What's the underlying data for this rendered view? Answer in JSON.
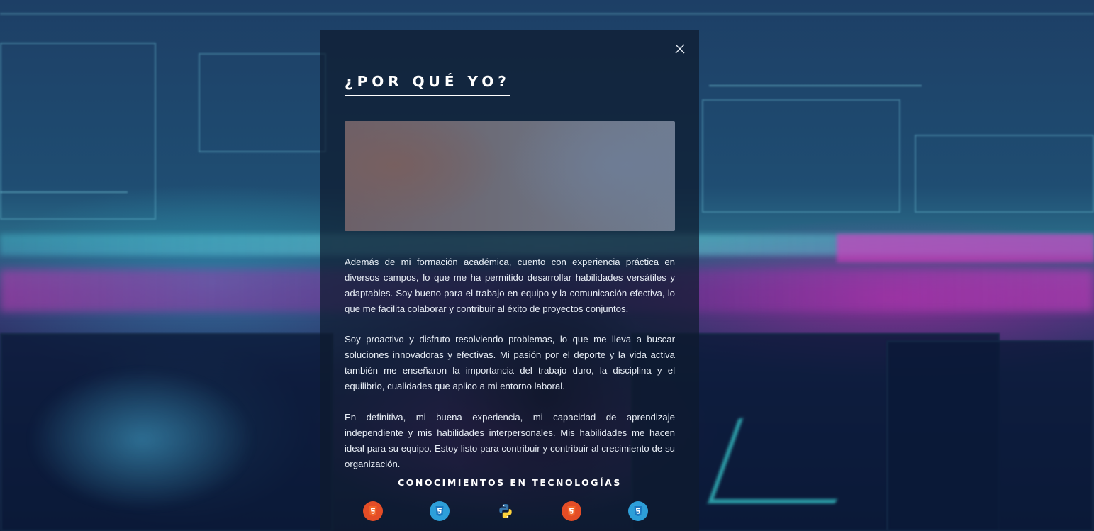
{
  "modal": {
    "title": "¿POR QUÉ YO?",
    "paragraphs": [
      "Además de mi formación académica, cuento con experiencia práctica en diversos campos, lo que me ha permitido desarrollar habilidades versátiles y adaptables. Soy bueno para el trabajo en equipo y la comunicación efectiva, lo que me facilita colaborar y contribuir al éxito de proyectos conjuntos.",
      "Soy proactivo y disfruto resolviendo problemas, lo que me lleva a buscar soluciones innovadoras y efectivas. Mi pasión por el deporte y la vida activa también me enseñaron la importancia del trabajo duro, la disciplina y el equilibrio, cualidades que aplico a mi entorno laboral.",
      "En definitiva, mi buena experiencia, mi capacidad de aprendizaje independiente y mis habilidades interpersonales. Mis habilidades me hacen ideal para su equipo. Estoy listo para contribuir y contribuir al crecimiento de su organización."
    ],
    "close_icon": "close-icon",
    "tech_section_title": "CONOCIMIENTOS EN TECNOLOGÍAS",
    "tech_icons": [
      {
        "icon": "html5-icon",
        "color": "#e44d26"
      },
      {
        "icon": "css3-icon",
        "color": "#2d9fd9"
      },
      {
        "icon": "python-icon",
        "color": "#3776ab"
      },
      {
        "icon": "html5-icon",
        "color": "#e44d26"
      },
      {
        "icon": "css3-icon",
        "color": "#2d9fd9"
      }
    ]
  },
  "colors": {
    "overlay": "#0e1a2e",
    "text": "#e8eef6",
    "heading": "#ffffff"
  }
}
